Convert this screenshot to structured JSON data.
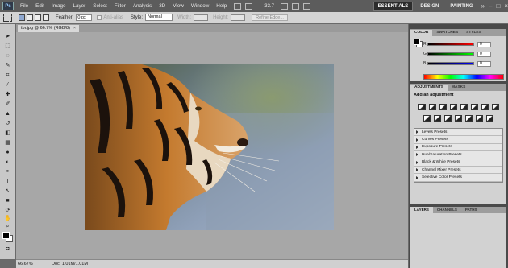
{
  "menubar": {
    "logo": "Ps",
    "items": [
      "File",
      "Edit",
      "Image",
      "Layer",
      "Select",
      "Filter",
      "Analysis",
      "3D",
      "View",
      "Window",
      "Help"
    ],
    "zoom": "33.7",
    "workspaces": [
      "ESSENTIALS",
      "DESIGN",
      "PAINTING"
    ],
    "more": "»"
  },
  "options": {
    "feather_label": "Feather:",
    "feather_value": "0 px",
    "antialias_label": "Anti-alias",
    "style_label": "Style:",
    "style_value": "Normal",
    "width_label": "Width:",
    "height_label": "Height:",
    "refine_label": "Refine Edge..."
  },
  "document": {
    "tab_title": "tbr.jpg @ 66.7% (RGB/8)",
    "close": "×",
    "status_zoom": "66.67%",
    "status_doc": "Doc: 1.01M/1.01M"
  },
  "color_panel": {
    "tabs": [
      "COLOR",
      "SWATCHES",
      "STYLES"
    ],
    "channels": [
      {
        "label": "R",
        "value": "0",
        "color": "#ff0000"
      },
      {
        "label": "G",
        "value": "0",
        "color": "#00ff00"
      },
      {
        "label": "B",
        "value": "0",
        "color": "#0000ff"
      }
    ]
  },
  "adjust_panel": {
    "tabs": [
      "ADJUSTMENTS",
      "MASKS"
    ],
    "title": "Add an adjustment",
    "presets": [
      "Levels Presets",
      "Curves Presets",
      "Exposure Presets",
      "Hue/Saturation Presets",
      "Black & White Presets",
      "Channel Mixer Presets",
      "Selective Color Presets"
    ]
  },
  "layers_panel": {
    "tabs": [
      "LAYERS",
      "CHANNELS",
      "PATHS"
    ]
  }
}
